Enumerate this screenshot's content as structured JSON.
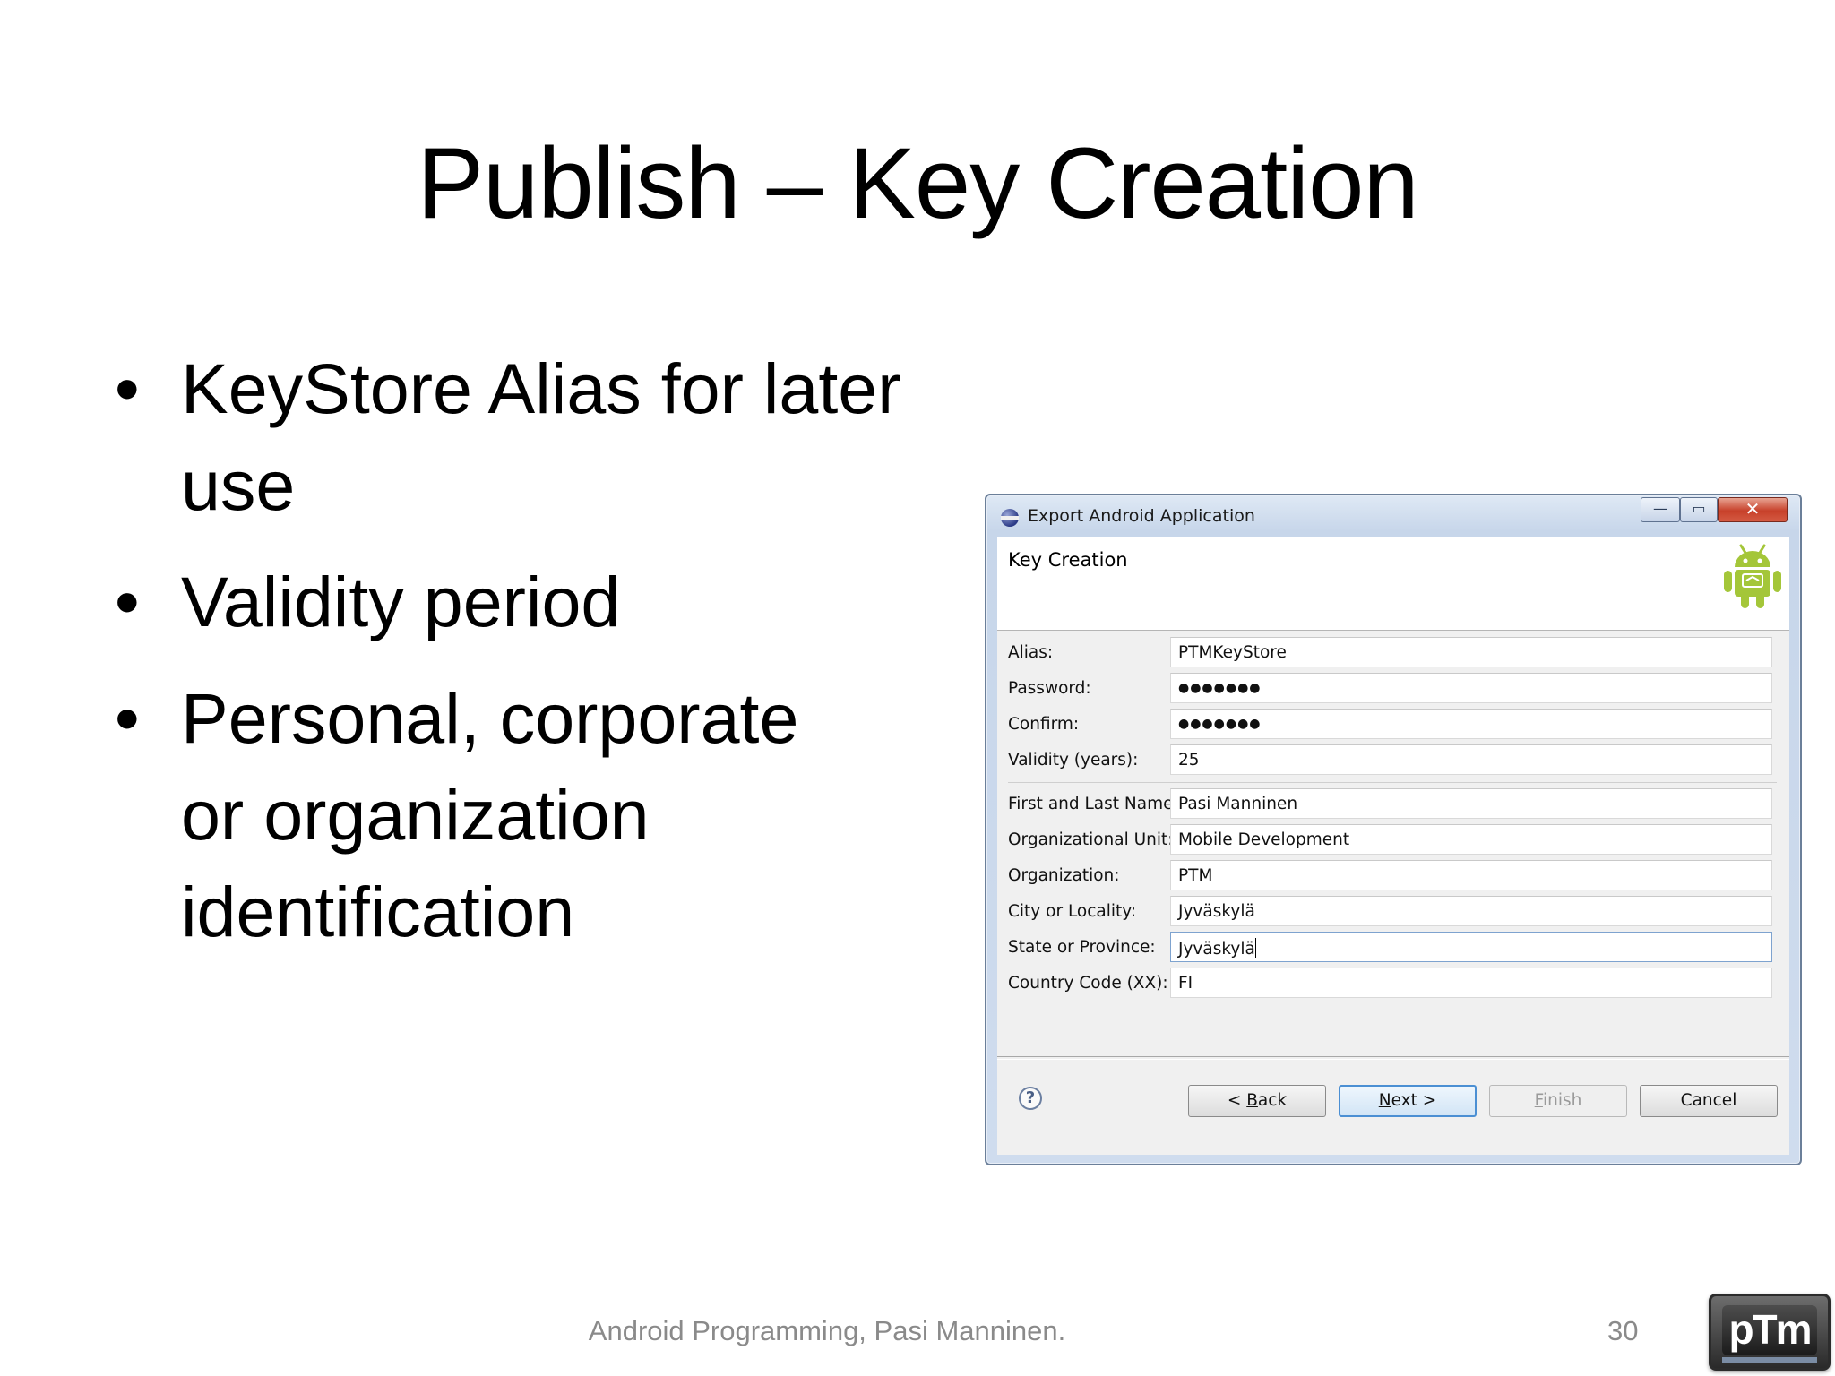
{
  "slide": {
    "title": "Publish – Key Creation",
    "bullets": [
      "KeyStore Alias for later use",
      "Validity period",
      "Personal, corporate or organization identification"
    ],
    "footer": "Android Programming, Pasi Manninen.",
    "page_number": "30",
    "logo_text": "pTm"
  },
  "dialog": {
    "window_title": "Export Android Application",
    "window_buttons": {
      "minimize": "—",
      "maximize": "▭",
      "close": "✕"
    },
    "page_title": "Key Creation",
    "fields": [
      {
        "label": "Alias:",
        "value": "PTMKeyStore"
      },
      {
        "label": "Password:",
        "value": "●●●●●●●"
      },
      {
        "label": "Confirm:",
        "value": "●●●●●●●"
      },
      {
        "label": "Validity (years):",
        "value": "25"
      },
      {
        "label": "First and Last Name:",
        "value": "Pasi Manninen"
      },
      {
        "label": "Organizational Unit:",
        "value": "Mobile Development"
      },
      {
        "label": "Organization:",
        "value": "PTM"
      },
      {
        "label": "City or Locality:",
        "value": "Jyväskylä"
      },
      {
        "label": "State or Province:",
        "value": "Jyväskylä"
      },
      {
        "label": "Country Code (XX):",
        "value": "FI"
      }
    ],
    "help_icon": "?",
    "buttons": {
      "back_prefix": "< ",
      "back_mnemonic": "B",
      "back_rest": "ack",
      "next_mnemonic": "N",
      "next_rest": "ext >",
      "finish_mnemonic": "F",
      "finish_rest": "inish",
      "cancel": "Cancel"
    }
  },
  "icons": {
    "app": "eclipse-icon",
    "banner": "android-icon",
    "help": "help-icon"
  },
  "colors": {
    "dialog_frame": "#c7d6ea",
    "close_button": "#c7402a",
    "default_button_border": "#4b8fd3",
    "android_green": "#a4c639",
    "footer_text": "#8a8a8a"
  }
}
